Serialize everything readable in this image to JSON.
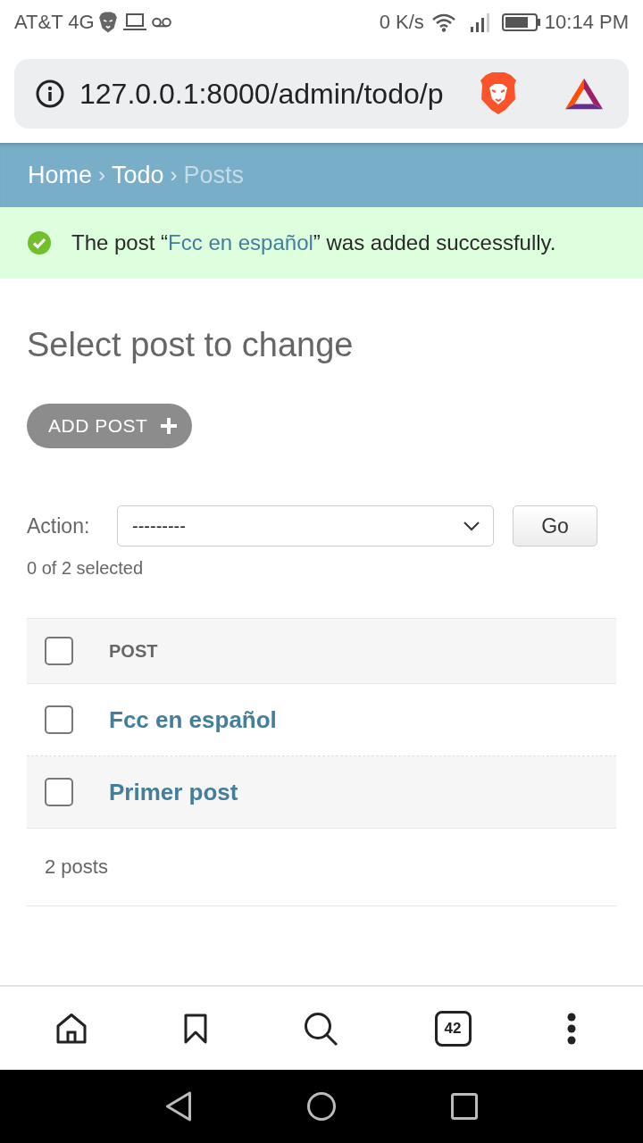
{
  "status_bar": {
    "carrier": "AT&T 4G",
    "speed": "0 K/s",
    "time": "10:14 PM"
  },
  "address_bar": {
    "url": "127.0.0.1:8000/admin/todo/p"
  },
  "breadcrumbs": [
    {
      "kind": "link",
      "label": "Home"
    },
    {
      "kind": "separator",
      "label": "›"
    },
    {
      "kind": "link",
      "label": "Todo"
    },
    {
      "kind": "separator",
      "label": "›"
    },
    {
      "kind": "current",
      "label": "Posts"
    }
  ],
  "message": {
    "kind": "success",
    "text_before": "The post “",
    "link": "Fcc en español",
    "text_after": "” was added successfully."
  },
  "title": "Select post to change",
  "add_button": "ADD POST",
  "actions": {
    "label": "Action:",
    "value": "---------",
    "button": "Go",
    "counter": "0 of 2 selected"
  },
  "table": {
    "select_all": {
      "checked": false
    },
    "columns": [
      {
        "label": "POST"
      }
    ],
    "rows": [
      {
        "title": "Fcc en español",
        "checked": false
      },
      {
        "title": "Primer post",
        "checked": false
      }
    ],
    "footer": "2 posts"
  },
  "toolbar": {
    "tab_count": "42"
  }
}
